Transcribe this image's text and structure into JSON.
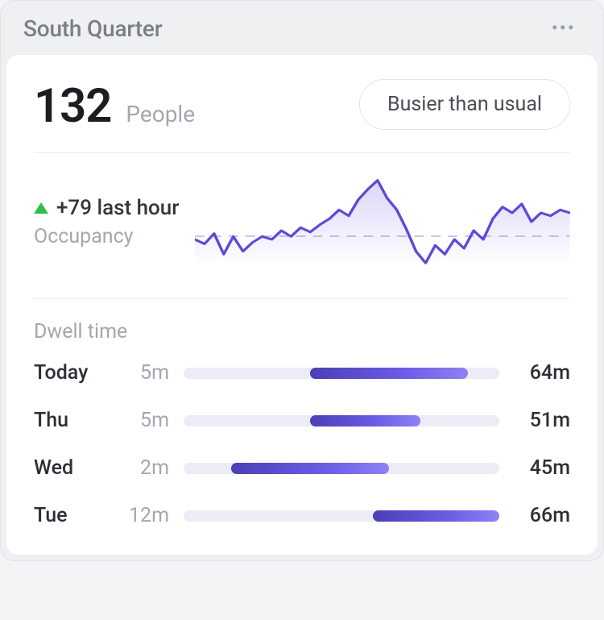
{
  "header": {
    "title": "South Quarter",
    "more_icon": "more-horizontal"
  },
  "summary": {
    "count": "132",
    "count_label": "People",
    "status_pill": "Busier than usual"
  },
  "occupancy": {
    "delta_text": "+79 last hour",
    "delta_direction": "up",
    "label": "Occupancy"
  },
  "dwell": {
    "title": "Dwell time",
    "rows": [
      {
        "day": "Today",
        "min": "5m",
        "max": "64m",
        "bar_start": 40,
        "bar_end": 90
      },
      {
        "day": "Thu",
        "min": "5m",
        "max": "51m",
        "bar_start": 40,
        "bar_end": 75
      },
      {
        "day": "Wed",
        "min": "2m",
        "max": "45m",
        "bar_start": 15,
        "bar_end": 65
      },
      {
        "day": "Tue",
        "min": "12m",
        "max": "66m",
        "bar_start": 60,
        "bar_end": 100
      }
    ]
  },
  "chart_data": {
    "type": "area",
    "title": "Occupancy",
    "series": [
      {
        "name": "Occupancy",
        "values": [
          58,
          55,
          62,
          48,
          60,
          50,
          56,
          60,
          58,
          64,
          60,
          66,
          63,
          68,
          72,
          78,
          74,
          85,
          92,
          98,
          86,
          78,
          65,
          50,
          42,
          54,
          48,
          58,
          52,
          64,
          58,
          72,
          80,
          76,
          82,
          70,
          76,
          74,
          78,
          76
        ]
      }
    ],
    "ylim": [
      40,
      100
    ],
    "baseline": 60,
    "xlabel": "",
    "ylabel": ""
  },
  "colors": {
    "accent": "#6150d8",
    "accent_light": "#8e82f2",
    "positive": "#2fbf4a",
    "muted": "#a3a7b0",
    "text": "#1b1d22"
  }
}
